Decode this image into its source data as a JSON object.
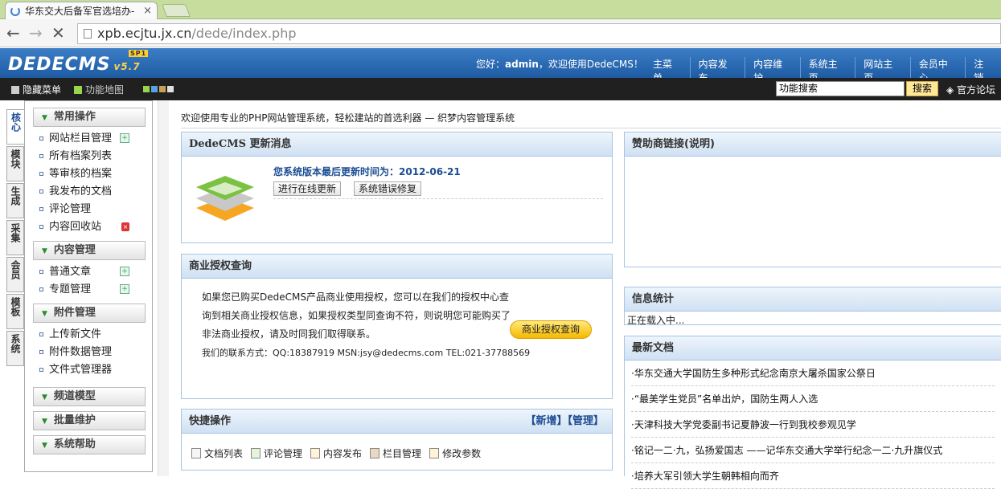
{
  "browser": {
    "tab_title": "华东交大后备军官选培办-",
    "tab_close": "×",
    "url_host": "xpb.ecjtu.jx.cn",
    "url_path": "/dede/index.php"
  },
  "header": {
    "logo": "DEDECMS",
    "version": "v5.7",
    "sp": "SP1",
    "greeting_prefix": "您好：",
    "user": "admin",
    "greeting_suffix": "，欢迎使用DedeCMS！",
    "nav": [
      "主菜单",
      "内容发布",
      "内容维护",
      "系统主页",
      "网站主页",
      "会员中心",
      "注销"
    ]
  },
  "toolbar": {
    "hide_menu": "隐藏菜单",
    "func_map": "功能地图",
    "skin_colors": [
      "#9bd34a",
      "#5aa0e6",
      "#c9a05a",
      "#e0e0e0"
    ],
    "search_placeholder": "功能搜索",
    "search_btn": "搜索",
    "forum": "官方论坛"
  },
  "left_tabs": [
    "核心",
    "模块",
    "生成",
    "采集",
    "会员",
    "模板",
    "系统"
  ],
  "menu": {
    "groups": [
      {
        "title": "常用操作",
        "items": [
          "网站栏目管理",
          "所有档案列表",
          "等审核的档案",
          "我发布的文档",
          "评论管理",
          "内容回收站"
        ]
      },
      {
        "title": "内容管理",
        "items": [
          "普通文章",
          "专题管理"
        ]
      },
      {
        "title": "附件管理",
        "items": [
          "上传新文件",
          "附件数据管理",
          "文件式管理器"
        ]
      },
      {
        "title": "频道模型",
        "items": []
      },
      {
        "title": "批量维护",
        "items": []
      },
      {
        "title": "系统帮助",
        "items": []
      }
    ]
  },
  "welcome": "欢迎使用专业的PHP网站管理系统，轻松建站的首选利器 — 织梦内容管理系统",
  "update": {
    "title_a": "DedeCMS",
    "title_b": " 更新消息",
    "date": "您系统版本最后更新时间为：2012-06-21",
    "btn_online": "进行在线更新",
    "btn_fix": "系统错误修复"
  },
  "license": {
    "title": "商业授权查询",
    "text": "如果您已购买DedeCMS产品商业使用授权，您可以在我们的授权中心查询到相关商业授权信息，如果授权类型同查询不符，则说明您可能购买了非法商业授权，请及时同我们取得联系。",
    "contact": "我们的联系方式：QQ:18387919 MSN:jsy@dedecms.com TEL:021-37788569",
    "btn": "商业授权查询"
  },
  "quick": {
    "title": "快捷操作",
    "actions_right": "【新增】【管理】",
    "items": [
      "文档列表",
      "评论管理",
      "内容发布",
      "栏目管理",
      "修改参数"
    ]
  },
  "sponsor": {
    "title": "赞助商链接(说明)"
  },
  "stats": {
    "title": "信息统计",
    "loading": "正在载入中..."
  },
  "news": {
    "title": "最新文档",
    "items": [
      "·华东交通大学国防生多种形式纪念南京大屠杀国家公祭日",
      "·“最美学生党员”名单出炉，国防生两人入选",
      "·天津科技大学党委副书记夏静波一行到我校参观见学",
      "·铭记一二·九，弘扬爱国志 ——记华东交通大学举行纪念一二·九升旗仪式",
      "·培养大军引领大学生朝韩相向而齐"
    ]
  }
}
